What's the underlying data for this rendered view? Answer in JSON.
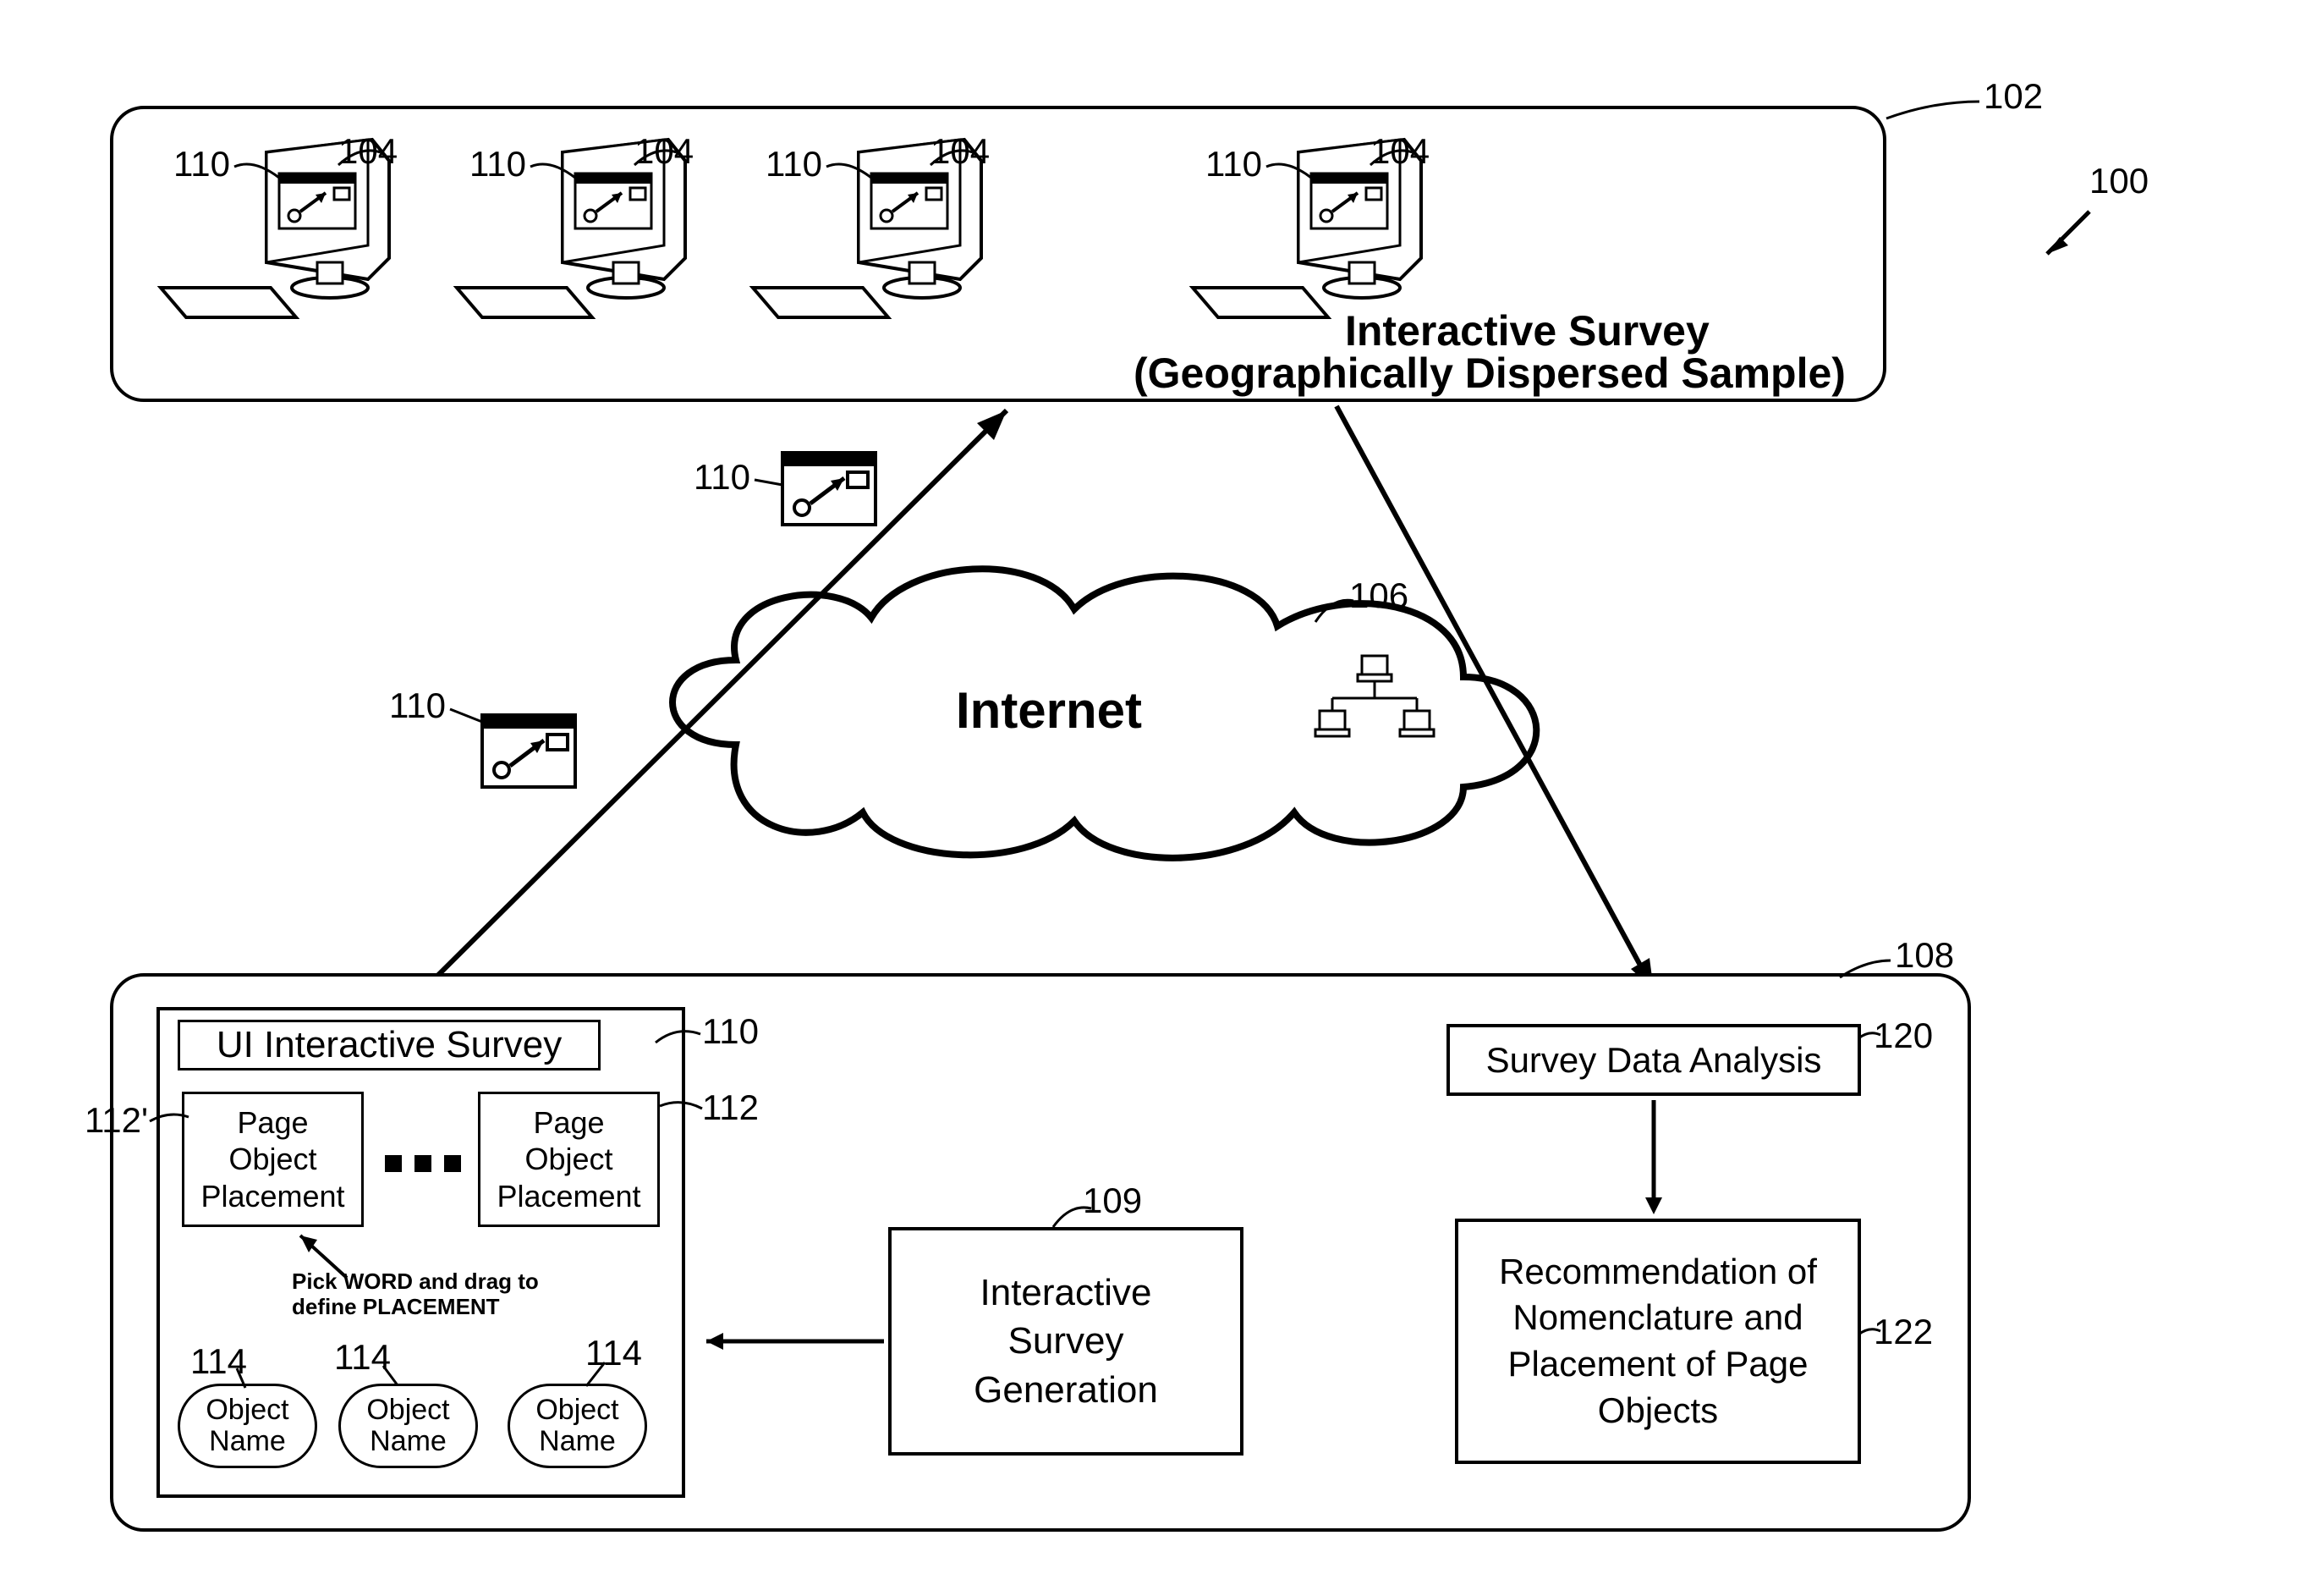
{
  "refs": {
    "fig": "100",
    "topBox": "102",
    "computer": "104",
    "cloud": "106",
    "bottomBox": "108",
    "surveyGen": "109",
    "ui110": "110",
    "ui110_a": "110",
    "ui110_b": "110",
    "ui110_c": "110",
    "ui110_d": "110",
    "ui110_e": "110",
    "ui110_f": "110",
    "ui110_g": "110",
    "page112": "112",
    "page112p": "112'",
    "obj114_a": "114",
    "obj114_b": "114",
    "obj114_c": "114",
    "analysis": "120",
    "recommend": "122"
  },
  "topBox": {
    "title1": "Interactive Survey",
    "title2": "(Geographically Dispersed Sample)"
  },
  "cloud": {
    "label": "Internet"
  },
  "uiSurvey": {
    "title": "UI Interactive Survey",
    "page1": "Page\nObject\nPlacement",
    "page2": "Page\nObject\nPlacement",
    "hint": "Pick WORD and drag to\ndefine PLACEMENT",
    "obj1": "Object\nName",
    "obj2": "Object\nName",
    "obj3": "Object\nName"
  },
  "surveyGen": {
    "label": "Interactive\nSurvey\nGeneration"
  },
  "analysis": {
    "label": "Survey Data Analysis"
  },
  "recommend": {
    "label": "Recommendation of\nNomenclature and\nPlacement of Page\nObjects"
  }
}
